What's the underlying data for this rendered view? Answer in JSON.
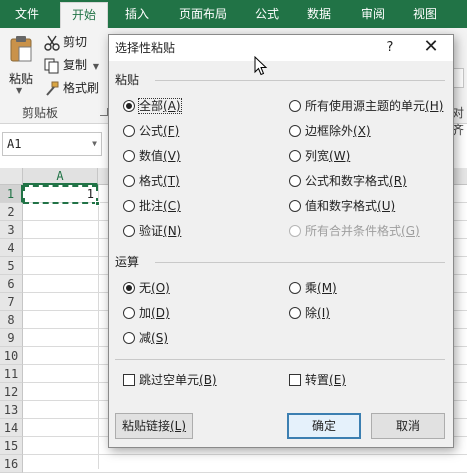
{
  "ribbon": {
    "tabs": [
      "文件",
      "开始",
      "插入",
      "页面布局",
      "公式",
      "数据",
      "审阅",
      "视图"
    ],
    "clipboard": {
      "paste": "粘贴",
      "cut": "剪切",
      "copy": "复制",
      "format_painter": "格式刷",
      "group_label": "剪贴板"
    },
    "partial_right_label": "对齐",
    "accent": "#217346"
  },
  "formula_bar": {
    "name_box": "A1"
  },
  "sheet": {
    "column_header": "A",
    "rows": [
      "1",
      "2",
      "3",
      "4",
      "5",
      "6",
      "7",
      "8",
      "9",
      "10",
      "11",
      "12",
      "13",
      "14",
      "15",
      "16"
    ],
    "a1_value": "1"
  },
  "dialog": {
    "title": "选择性粘贴",
    "help": "?",
    "close": "✕",
    "paste_section": "粘贴",
    "paste_left": [
      {
        "label": "全部",
        "key": "(A)",
        "checked": true
      },
      {
        "label": "公式",
        "key": "(F)",
        "checked": false
      },
      {
        "label": "数值",
        "key": "(V)",
        "checked": false
      },
      {
        "label": "格式",
        "key": "(T)",
        "checked": false
      },
      {
        "label": "批注",
        "key": "(C)",
        "checked": false
      },
      {
        "label": "验证",
        "key": "(N)",
        "checked": false
      }
    ],
    "paste_right": [
      {
        "label": "所有使用源主题的单元",
        "key": "(H)",
        "checked": false
      },
      {
        "label": "边框除外",
        "key": "(X)",
        "checked": false
      },
      {
        "label": "列宽",
        "key": "(W)",
        "checked": false
      },
      {
        "label": "公式和数字格式",
        "key": "(R)",
        "checked": false
      },
      {
        "label": "值和数字格式",
        "key": "(U)",
        "checked": false
      },
      {
        "label": "所有合并条件格式",
        "key": "(G)",
        "checked": false
      }
    ],
    "operation_section": "运算",
    "op_left": [
      {
        "label": "无",
        "key": "(O)",
        "checked": true
      },
      {
        "label": "加",
        "key": "(D)",
        "checked": false
      },
      {
        "label": "减",
        "key": "(S)",
        "checked": false
      }
    ],
    "op_right": [
      {
        "label": "乘",
        "key": "(M)",
        "checked": false
      },
      {
        "label": "除",
        "key": "(I)",
        "checked": false
      }
    ],
    "skip_blanks": {
      "label": "跳过空单元",
      "key": "(B)",
      "checked": false
    },
    "transpose": {
      "label": "转置",
      "key": "(E)",
      "checked": false
    },
    "paste_link": {
      "label": "粘贴链接",
      "key": "(L)"
    },
    "ok": "确定",
    "cancel": "取消"
  }
}
